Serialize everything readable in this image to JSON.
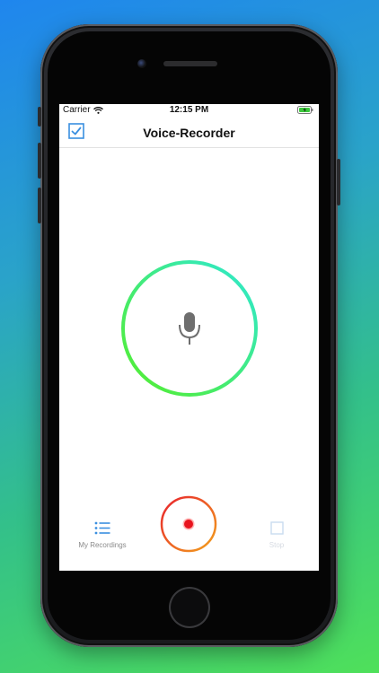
{
  "status_bar": {
    "carrier": "Carrier",
    "time": "12:15 PM"
  },
  "nav": {
    "title": "Voice-Recorder",
    "left_icon": "checkmark-square-icon"
  },
  "center": {
    "icon": "microphone-icon"
  },
  "tabbar": {
    "recordings_label": "My Recordings",
    "stop_label": "Stop",
    "record_icon": "record-icon"
  },
  "colors": {
    "accent_blue": "#3a8fe0",
    "ring_start": "#55ee2a",
    "ring_end": "#2ee8d2",
    "record_red": "#e8222e",
    "record_orange": "#f2a11c"
  }
}
